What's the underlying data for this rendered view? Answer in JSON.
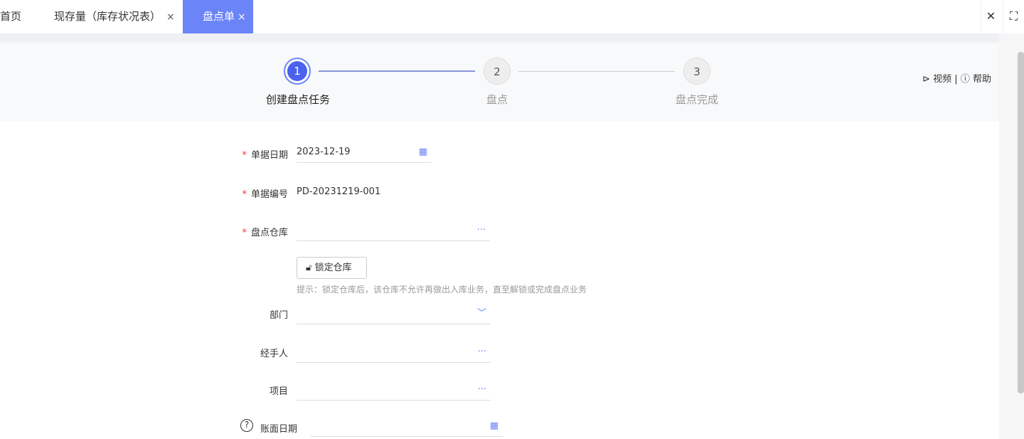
{
  "tabs": [
    {
      "label": "首页"
    },
    {
      "label": "现存量（库存状况表）",
      "close": "×"
    },
    {
      "label": "盘点单",
      "close": "×",
      "active": true
    }
  ],
  "window": {
    "close": "✕",
    "fullscreen": "⛶"
  },
  "steps": [
    {
      "num": "1",
      "label": "创建盘点任务"
    },
    {
      "num": "2",
      "label": "盘点"
    },
    {
      "num": "3",
      "label": "盘点完成"
    }
  ],
  "help": {
    "video": "视频",
    "separator": "|",
    "help": "帮助"
  },
  "form": {
    "required_mark": "*",
    "date": {
      "label": "单据日期",
      "value": "2023-12-19"
    },
    "number": {
      "label": "单据编号",
      "value": "PD-20231219-001"
    },
    "warehouse": {
      "label": "盘点仓库",
      "value": ""
    },
    "lock_button": "锁定仓库",
    "hint": "提示：锁定仓库后，该仓库不允许再做出入库业务，直至解锁或完成盘点业务",
    "department": {
      "label": "部门",
      "value": ""
    },
    "handler": {
      "label": "经手人",
      "value": ""
    },
    "project": {
      "label": "项目",
      "value": ""
    },
    "book_date": {
      "label": "账面日期",
      "value": ""
    }
  },
  "colors": {
    "accent": "#6b84f7",
    "step_active": "#4a62ee",
    "required": "#e53935"
  }
}
